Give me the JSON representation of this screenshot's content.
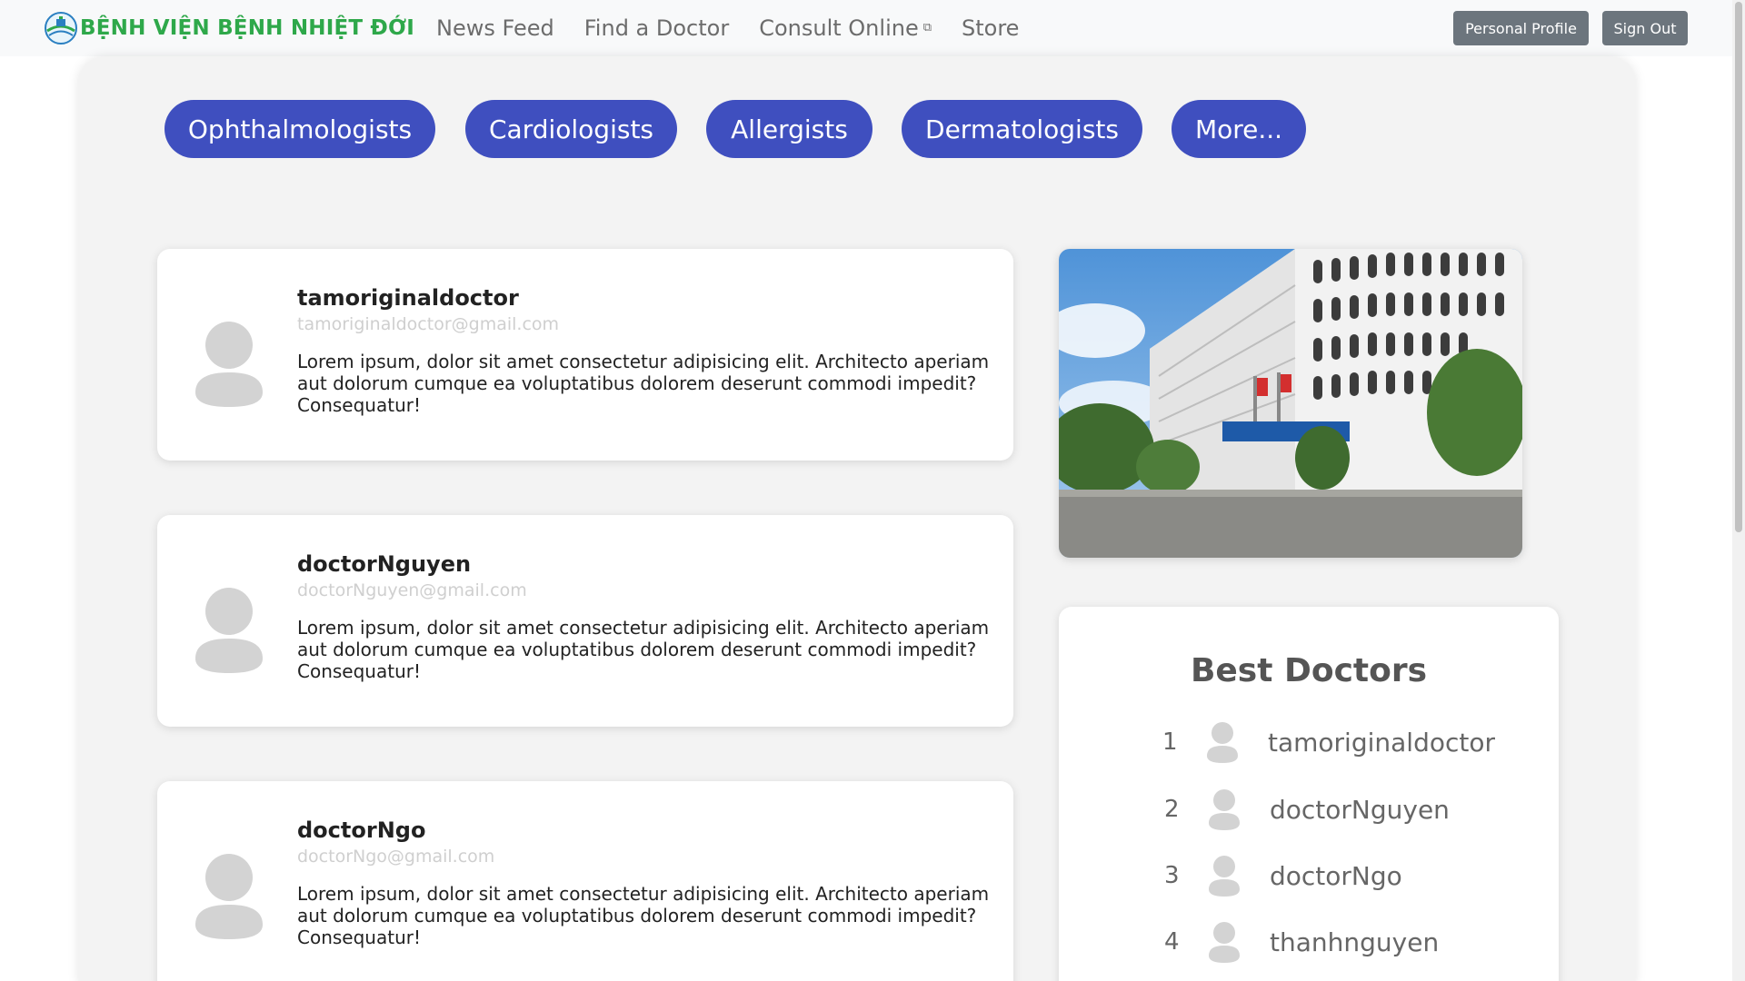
{
  "navbar": {
    "brand": "BỆNH VIỆN BỆNH NHIỆT ĐỚI",
    "links": [
      "News Feed",
      "Find a Doctor",
      "Consult Online",
      "Store"
    ],
    "profile_button": "Personal Profile",
    "signout_button": "Sign Out"
  },
  "specialties": [
    "Ophthalmologists",
    "Cardiologists",
    "Allergists",
    "Dermatologists",
    "More..."
  ],
  "doctors": [
    {
      "username": "tamoriginaldoctor",
      "email": "tamoriginaldoctor@gmail.com",
      "bio": "Lorem ipsum, dolor sit amet consectetur adipisicing elit. Architecto aperiam aut dolorum cumque ea voluptatibus dolorem deserunt commodi impedit? Consequatur!"
    },
    {
      "username": "doctorNguyen",
      "email": "doctorNguyen@gmail.com",
      "bio": "Lorem ipsum, dolor sit amet consectetur adipisicing elit. Architecto aperiam aut dolorum cumque ea voluptatibus dolorem deserunt commodi impedit? Consequatur!"
    },
    {
      "username": "doctorNgo",
      "email": "doctorNgo@gmail.com",
      "bio": "Lorem ipsum, dolor sit amet consectetur adipisicing elit. Architecto aperiam aut dolorum cumque ea voluptatibus dolorem deserunt commodi impedit? Consequatur!"
    }
  ],
  "best_doctors": {
    "title": "Best Doctors",
    "ranking": [
      {
        "rank": "1",
        "name": "tamoriginaldoctor"
      },
      {
        "rank": "2",
        "name": "doctorNguyen"
      },
      {
        "rank": "3",
        "name": "doctorNgo"
      },
      {
        "rank": "4",
        "name": "thanhnguyen"
      }
    ]
  },
  "colors": {
    "brand_green": "#2ea84a",
    "pill_blue": "#3f4fbf",
    "nav_button_gray": "#6c757d"
  },
  "icons": {
    "brand_logo": "hospital-globe-logo",
    "external_link": "external-link-icon",
    "avatar": "user-silhouette-icon"
  }
}
